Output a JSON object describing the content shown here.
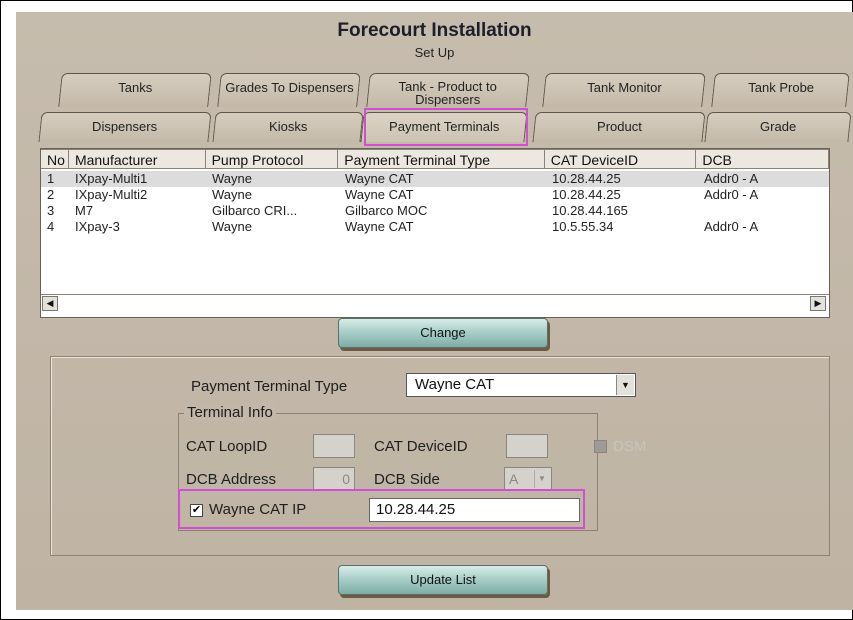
{
  "window": {
    "title": "Forecourt Installation",
    "subtitle": "Set Up"
  },
  "tabs_row1": [
    "Tanks",
    "Grades To Dispensers",
    "Tank - Product to Dispensers",
    "Tank Monitor",
    "Tank Probe"
  ],
  "tabs_row2": [
    "Dispensers",
    "Kiosks",
    "Payment Terminals",
    "Product",
    "Grade"
  ],
  "grid": {
    "headers": [
      "No",
      "Manufacturer",
      "Pump Protocol",
      "Payment Terminal Type",
      "CAT DeviceID",
      "DCB"
    ],
    "rows": [
      [
        "1",
        "IXpay-Multi1",
        "Wayne",
        "Wayne CAT",
        "10.28.44.25",
        "Addr0 - A"
      ],
      [
        "2",
        "IXpay-Multi2",
        "Wayne",
        "Wayne CAT",
        "10.28.44.25",
        "Addr0 - A"
      ],
      [
        "3",
        "M7",
        "Gilbarco CRI...",
        "Gilbarco MOC",
        "10.28.44.165",
        ""
      ],
      [
        "4",
        "IXpay-3",
        "Wayne",
        "Wayne CAT",
        "10.5.55.34",
        "Addr0 - A"
      ]
    ],
    "selected_row": 0
  },
  "buttons": {
    "change": "Change",
    "update_list": "Update List"
  },
  "form": {
    "payment_terminal_type_label": "Payment Terminal Type",
    "payment_terminal_type_value": "Wayne CAT",
    "terminal_info_label": "Terminal Info",
    "cat_loopid_label": "CAT LoopID",
    "cat_deviceid_label": "CAT DeviceID",
    "dsm_label": "DSM",
    "dcb_address_label": "DCB Address",
    "dcb_address_value": "0",
    "dcb_side_label": "DCB Side",
    "dcb_side_value": "A",
    "wayne_cat_ip_label": "Wayne CAT IP",
    "wayne_cat_ip_checked": "✔",
    "wayne_cat_ip_value": "10.28.44.25"
  },
  "colors": {
    "highlight": "#d14fd0",
    "panel": "#c2b7a8",
    "button": "#a9cfc8"
  }
}
